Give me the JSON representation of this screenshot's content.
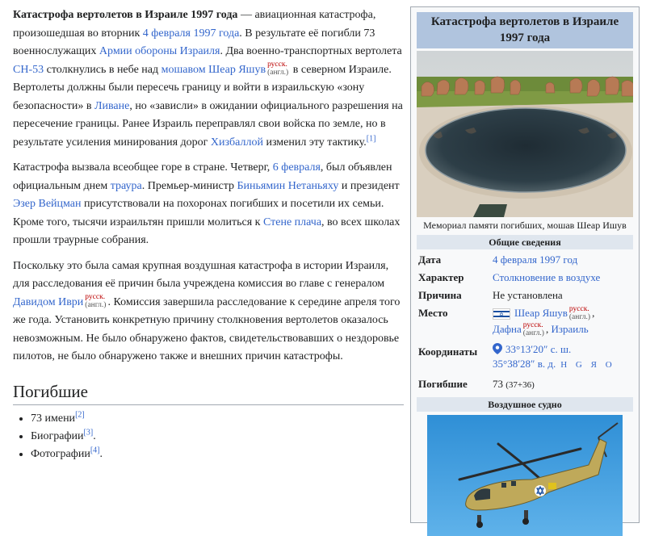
{
  "article": {
    "p1": {
      "title_bold": "Катастрофа вертолетов в Израиле 1997 года",
      "t1": " — авиационная катастрофа, произошедшая во вторник ",
      "link_date": "4 февраля 1997 года",
      "t2": ". В результате её погибли 73 военнослужащих ",
      "link_army": "Армии обороны Израиля",
      "t3": ". Два военно-транспортных вертолета ",
      "link_ch53": "CH-53",
      "t4": " столкнулись в небе над ",
      "link_moshav": "мошавом Шеар Яшув",
      "iw_rus": "русск.",
      "iw_eng": "(англ.)",
      "t5": " в северном Израиле. Вертолеты должны были пересечь границу и войти в израильскую «зону безопасности» в ",
      "link_lebanon": "Ливане",
      "t6": ", но «зависли» в ожидании официального разрешения на пересечение границы. Ранее Израиль переправлял свои войска по земле, но в результате усиления минирования дорог ",
      "link_hezbollah": "Хизбаллой",
      "t7": " изменил эту тактику.",
      "ref": "[1]"
    },
    "p2": {
      "t1": "Катастрофа вызвала всеобщее горе в стране. Четверг, ",
      "link_feb6": "6 февраля",
      "t2": ", был объявлен официальным днем ",
      "link_mourning": "траура",
      "t3": ". Премьер-министр ",
      "link_netanyahu": "Биньямин Нетаньяху",
      "t4": " и президент ",
      "link_weizman": "Эзер Вейцман",
      "t5": " присутствовали на похоронах погибших и посетили их семьи. Кроме того, тысячи израильтян пришли молиться к ",
      "link_wall": "Стене плача",
      "t6": ", во всех школах прошли траурные собрания."
    },
    "p3": {
      "t1": "Поскольку это была самая крупная воздушная катастрофа в истории Израиля, для расследования её причин была учреждена комиссия во главе с генералом ",
      "link_ivri": "Давидом Иври",
      "iw_rus": "русск.",
      "iw_eng": "(англ.)",
      "t2": ". Комиссия завершила расследование к середине апреля того же года. Установить конкретную причину столкновения вертолетов оказалось невозможным. Не было обнаружено фактов, свидетельствовавших о нездоровье пилотов, не было обнаружено также и внешних причин катастрофы."
    },
    "section_heading": "Погибшие",
    "list": [
      {
        "text": "73 имени",
        "ref": "[2]",
        "end": ""
      },
      {
        "text": "Биографии",
        "ref": "[3]",
        "end": "."
      },
      {
        "text": "Фотографии",
        "ref": "[4]",
        "end": "."
      }
    ]
  },
  "infobox": {
    "title": "Катастрофа вертолетов в Израиле 1997 года",
    "caption": "Мемориал памяти погибших, мошав Шеар Ишув",
    "section_general": "Общие сведения",
    "date_label": "Дата",
    "date_value": "4 февраля 1997 год",
    "type_label": "Характер",
    "type_value": "Столкновение в воздухе",
    "cause_label": "Причина",
    "cause_value": "Не установлена",
    "place_label": "Место",
    "place_1": "Шеар Яшув",
    "place_2": "Дафна",
    "place_3": "Израиль",
    "iw_rus": "русск.",
    "iw_eng": "(англ.)",
    "coords_label": "Координаты",
    "coords_lat": "33°13′20″ с. ш.",
    "coords_lon": "35°38′28″ в. д.",
    "coords_geo": "H G Я O",
    "dead_label": "Погибшие",
    "dead_value": "73",
    "dead_detail": "(37+36)",
    "section_aircraft": "Воздушное судно",
    "colors": {
      "title_bg": "#b0c4de",
      "section_bg": "#dfe6ee",
      "link": "#3366cc",
      "interwiki": "#bb0000"
    }
  }
}
